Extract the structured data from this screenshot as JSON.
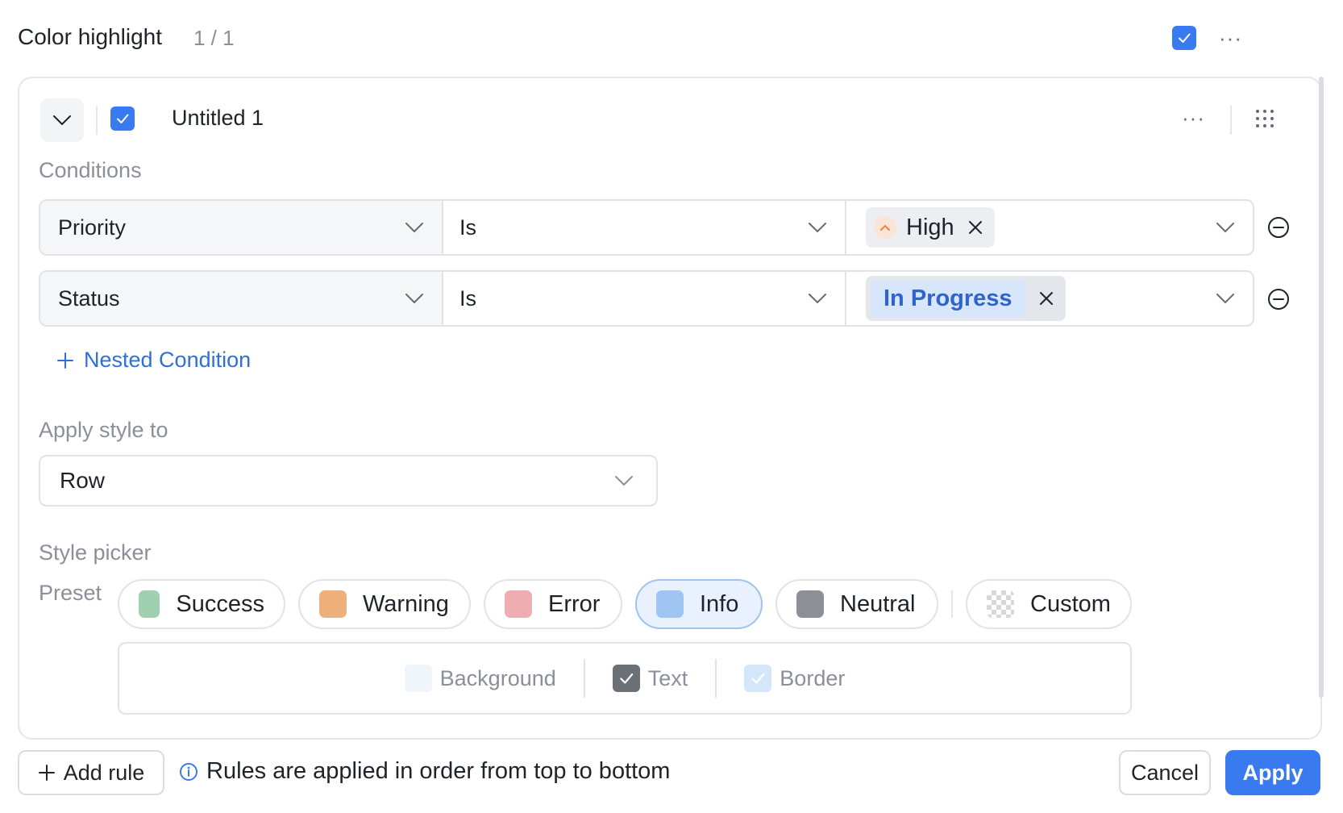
{
  "header": {
    "title": "Color highlight",
    "counter": "1 / 1",
    "more": "···"
  },
  "rule": {
    "name": "Untitled 1",
    "more": "···"
  },
  "conditions": {
    "label": "Conditions",
    "rows": [
      {
        "field": "Priority",
        "operator": "Is",
        "value": "High"
      },
      {
        "field": "Status",
        "operator": "Is",
        "value": "In Progress"
      }
    ],
    "nested_label": "Nested Condition"
  },
  "apply_style": {
    "label": "Apply style to",
    "value": "Row"
  },
  "style_picker": {
    "label": "Style picker",
    "preset_label": "Preset",
    "presets": [
      {
        "label": "Success",
        "color": "#9fd0b0"
      },
      {
        "label": "Warning",
        "color": "#eeb07a"
      },
      {
        "label": "Error",
        "color": "#eeadb0"
      },
      {
        "label": "Info",
        "color": "#9fc6f2"
      },
      {
        "label": "Neutral",
        "color": "#8c8f96"
      },
      {
        "label": "Custom",
        "color": "checker"
      }
    ],
    "selected": "Info",
    "targets": [
      {
        "label": "Background",
        "checked": false
      },
      {
        "label": "Text",
        "checked": true
      },
      {
        "label": "Border",
        "checked": true
      }
    ]
  },
  "footer": {
    "add_rule": "Add rule",
    "hint": "Rules are applied in order from top to bottom",
    "cancel": "Cancel",
    "apply": "Apply"
  },
  "colors": {
    "accent": "#3a7af0",
    "link": "#2f6fd6",
    "status_text": "#2f64c8"
  }
}
